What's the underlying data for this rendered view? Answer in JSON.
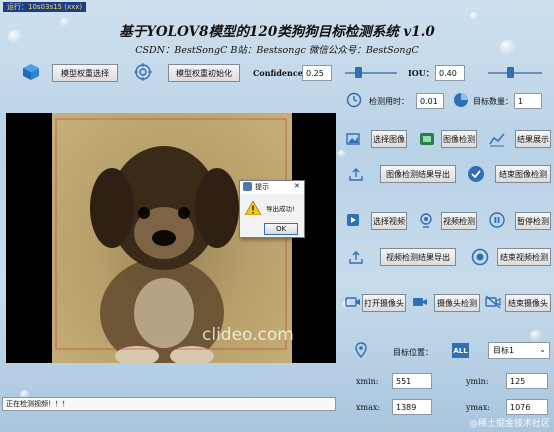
{
  "window": {
    "title": "运行：10s03s15 (xxx)"
  },
  "header": {
    "title": "基于YOLOV8模型的120类狗狗目标检测系统 v1.0",
    "subtitle": "CSDN：BestSongC   B站：Bestsongc   微信公众号：BestSongC"
  },
  "toolbar": {
    "model_select_label": "模型权重选择",
    "model_init_label": "模型权重初始化",
    "confidence_label": "Confidence:",
    "confidence_value": "0.25",
    "confidence_level": 0.25,
    "iou_label": "IOU：",
    "iou_value": "0.40",
    "iou_level": 0.4
  },
  "stats": {
    "time_label": "检测用时：",
    "time_value": "0.01",
    "count_label": "目标数量：",
    "count_value": "1"
  },
  "image_panel": {
    "select_label": "选择图像",
    "detect_label": "图像检测",
    "show_label": "结果展示",
    "export_label": "图像检测结果导出",
    "end_label": "结束图像检测"
  },
  "video_panel": {
    "select_label": "选择视频",
    "detect_label": "视频检测",
    "pause_label": "暂停检测",
    "export_label": "视频检测结果导出",
    "end_label": "结束视频检测"
  },
  "camera_panel": {
    "open_label": "打开摄像头",
    "detect_label": "摄像头检测",
    "end_label": "结束摄像头"
  },
  "position": {
    "label": "目标位置：",
    "target_selected": "目标1",
    "xmin_label": "xmin:",
    "xmin_value": "551",
    "ymin_label": "ymin:",
    "ymin_value": "125",
    "xmax_label": "xmax:",
    "xmax_value": "1389",
    "ymax_label": "ymax:",
    "ymax_value": "1076"
  },
  "image_area": {
    "watermark": "clideo.com"
  },
  "dialog": {
    "title": "提示",
    "message": "导出成功!",
    "ok_label": "OK",
    "close_glyph": "✕"
  },
  "status": {
    "text": "正在检测视频！！！"
  },
  "watermark": {
    "text": "@稀土掘金技术社区"
  },
  "colors": {
    "accent": "#2f6fb6",
    "title_bar": "#1c3e8a"
  }
}
